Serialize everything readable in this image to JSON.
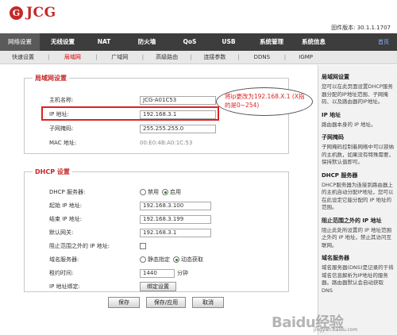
{
  "header": {
    "logo_mark": "G",
    "brand": "JCG",
    "firmware": "固件版本: 30.1.1.1707"
  },
  "mainnav": {
    "items": [
      "网络设置",
      "无线设置",
      "NAT",
      "防火墙",
      "QoS",
      "USB",
      "系统管理",
      "系统信息"
    ],
    "home": "首页"
  },
  "subnav": {
    "items": [
      "快速设置",
      "局域网",
      "广域网",
      "高级路由",
      "连接参数",
      "DDNS",
      "IGMP"
    ]
  },
  "lan": {
    "legend": "局域网设置",
    "host_label": "主机名称:",
    "host_value": "JCG-A01C53",
    "ip_label": "IP 地址:",
    "ip_value": "192.168.3.1",
    "mask_label": "子网掩码:",
    "mask_value": "255.255.255.0",
    "mac_label": "MAC 地址:",
    "mac_value": "00:E0:4B:A0:1C:53"
  },
  "annotation": {
    "text": "将ip更改为192.168.X.1 (X指的是0~254)"
  },
  "dhcp": {
    "legend": "DHCP 设置",
    "server_label": "DHCP 服务器:",
    "server_off": "禁用",
    "server_on": "启用",
    "start_label": "起始 IP 地址:",
    "start_value": "192.168.3.100",
    "end_label": "结束 IP 地址:",
    "end_value": "192.168.3.199",
    "gateway_label": "默认网关:",
    "gateway_value": "192.168.3.1",
    "block_label": "阻止范围之外的 IP 地址:",
    "dns_label": "域名服务器:",
    "dns_static": "静态指定",
    "dns_auto": "动态获取",
    "lease_label": "租约时间:",
    "lease_value": "1440",
    "lease_unit": "分钟",
    "bind_label": "IP 地址绑定:",
    "bind_button": "绑定设置"
  },
  "buttons": {
    "save": "保存",
    "save_apply": "保存/应用",
    "cancel": "取消"
  },
  "help": {
    "h1": "局域网设置",
    "p1": "您可以在此页面设置DHCP服务器分配的IP地址范围、子网掩码、以及路由器的IP地址。",
    "h2": "IP 地址",
    "p2": "路由器本身的 IP 地址。",
    "h3": "子网掩码",
    "p3": "子网掩码控制着网络中可以容纳的主机数，如果没有特殊需要，保持默认值即可。",
    "h4": "DHCP 服务器",
    "p4": "DHCP服务器为连接到路由器上的主机自动分配IP地址，您可以在此设定它能分配的 IP 地址的范围。",
    "h5": "阻止范围之外的 IP 地址",
    "p5": "阻止此处所设置的 IP 地址范围之外的 IP 地址，禁止其访问互联网。",
    "h6": "域名服务器",
    "p6": "域名服务器(DNS)是记录的于将域名信息解析为IP地址的服务器。路由器默认会自动获取 DNS"
  },
  "watermark": {
    "main": "Baidu经验",
    "sub": "jingyan.baidu.com"
  },
  "colors": {
    "accent": "#c62828",
    "nav_bg": "#3d3d3d",
    "annotation_red": "#dd2222"
  }
}
